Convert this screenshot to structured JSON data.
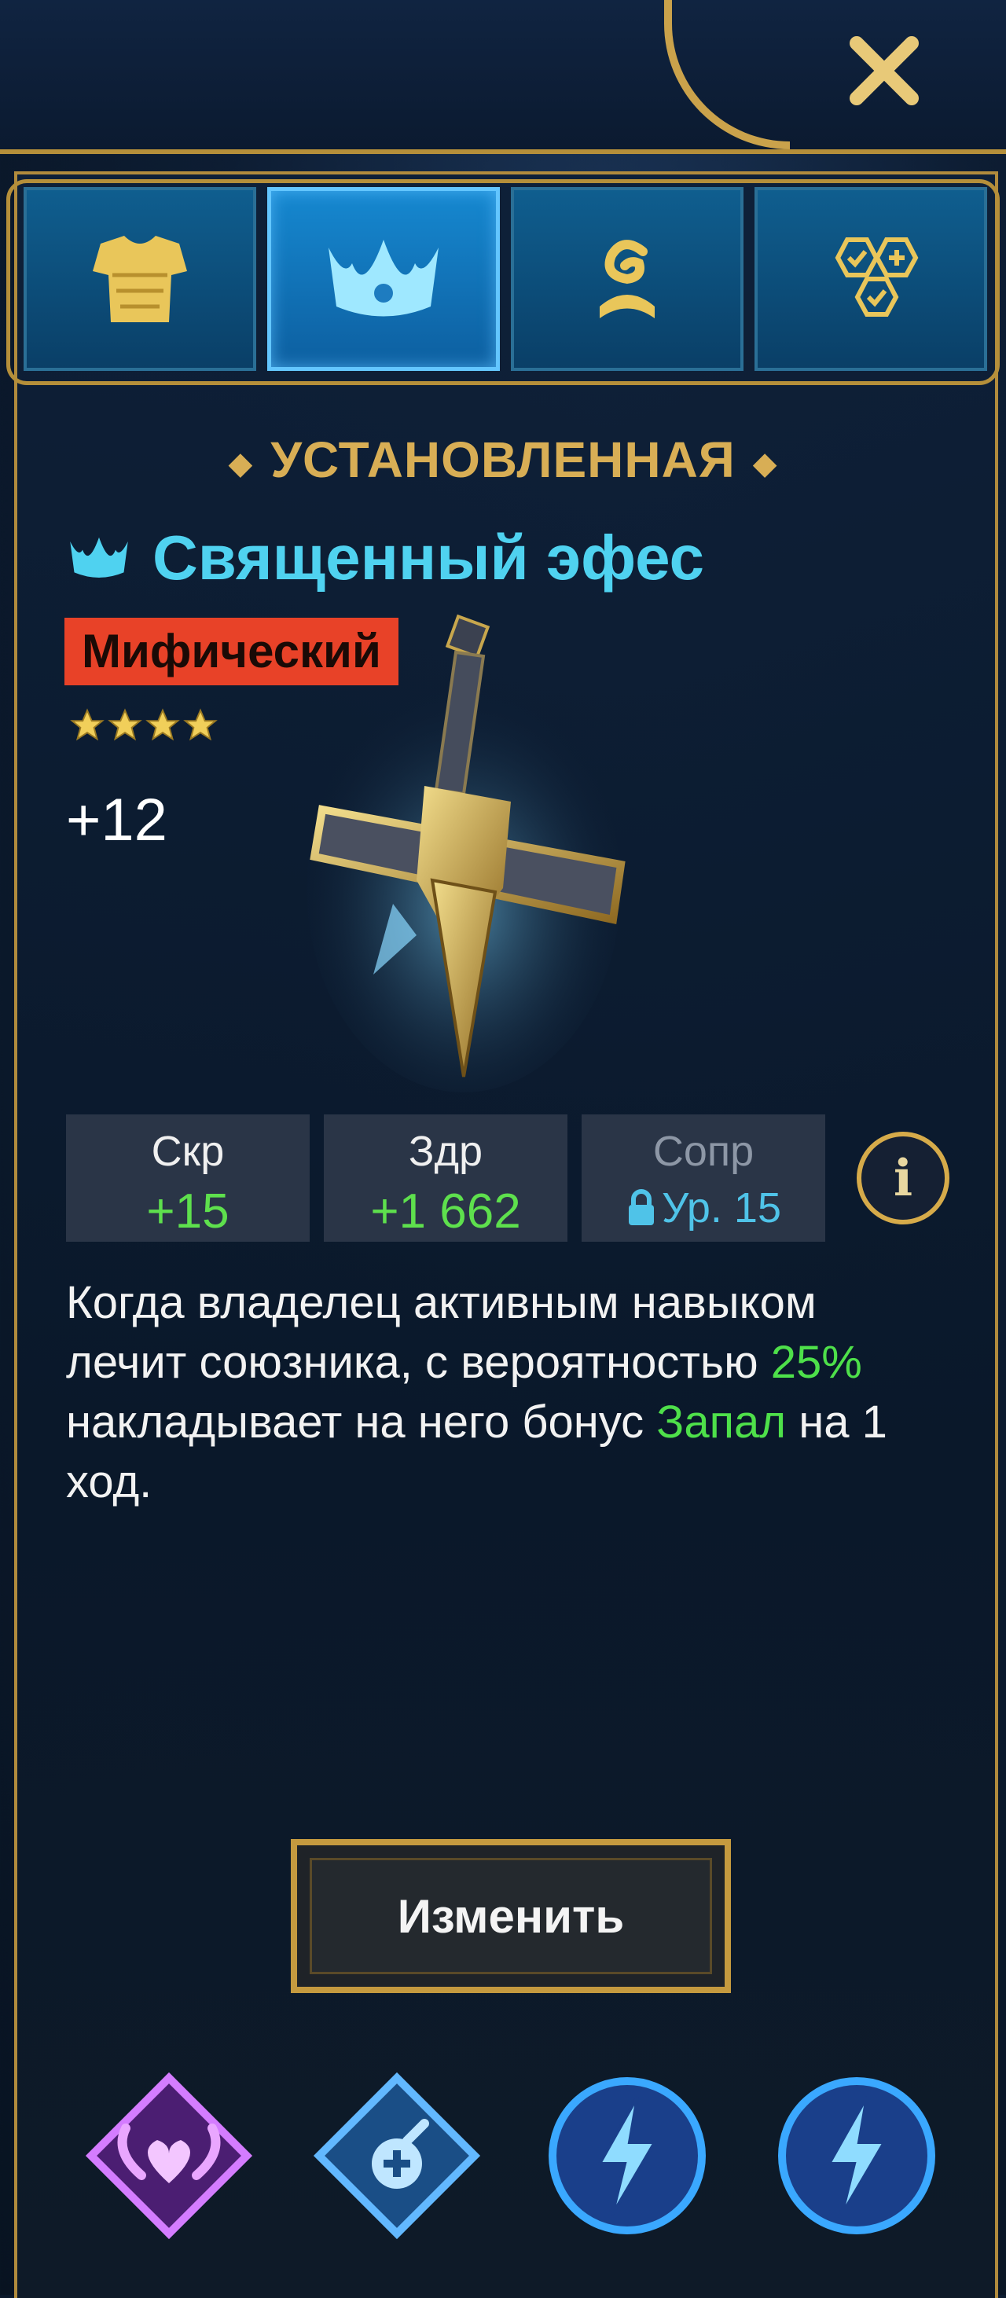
{
  "header": {
    "close_icon": "close-x-icon"
  },
  "tabs": [
    {
      "icon": "armor-icon",
      "active": false
    },
    {
      "icon": "crown-icon",
      "active": true
    },
    {
      "icon": "relic-scroll-icon",
      "active": false
    },
    {
      "icon": "set-bonus-icon",
      "active": false
    }
  ],
  "section_label": "УСТАНОВЛЕННАЯ",
  "item": {
    "title": "Священный эфес",
    "type_icon": "crown-icon",
    "rarity": "Мифический",
    "stars": 4,
    "level": "+12"
  },
  "stats": [
    {
      "name": "Скр",
      "value": "+15",
      "locked": false
    },
    {
      "name": "Здр",
      "value": "+1 662",
      "locked": false
    },
    {
      "name": "Сопр",
      "value": "Ур. 15",
      "locked": true
    }
  ],
  "description": {
    "p1": "Когда владелец активным навыком лечит союзника, с вероятностью ",
    "chance": "25%",
    "p2": " накладывает на него бонус ",
    "buff": "Запал",
    "p3": " на 1 ход."
  },
  "buttons": {
    "change": "Изменить"
  },
  "bottom_icons": [
    "wings-heart-icon",
    "potion-plus-icon",
    "lightning-icon",
    "lightning-icon"
  ],
  "colors": {
    "accent_gold": "#d8ae55",
    "title_cyan": "#4fd2f0",
    "rarity_red": "#e84228",
    "positive_green": "#5ee04d"
  }
}
